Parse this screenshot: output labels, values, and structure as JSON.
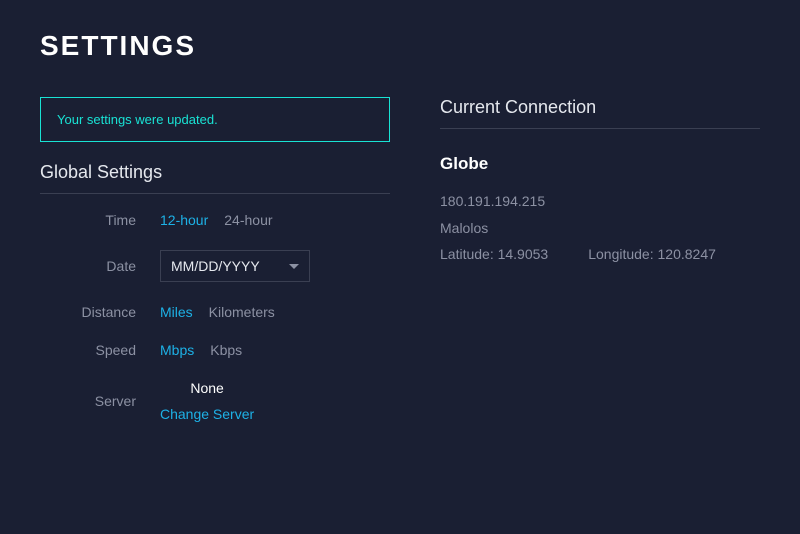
{
  "page": {
    "title": "SETTINGS"
  },
  "alert": {
    "message": "Your settings were updated."
  },
  "global": {
    "heading": "Global Settings",
    "time": {
      "label": "Time",
      "options": {
        "twelve": "12-hour",
        "twentyfour": "24-hour"
      }
    },
    "date": {
      "label": "Date",
      "selected": "MM/DD/YYYY"
    },
    "distance": {
      "label": "Distance",
      "options": {
        "miles": "Miles",
        "km": "Kilometers"
      }
    },
    "speed": {
      "label": "Speed",
      "options": {
        "mbps": "Mbps",
        "kbps": "Kbps"
      }
    },
    "server": {
      "label": "Server",
      "value": "None",
      "change": "Change Server"
    }
  },
  "connection": {
    "heading": "Current Connection",
    "isp": "Globe",
    "ip": "180.191.194.215",
    "city": "Malolos",
    "lat_label": "Latitude: 14.9053",
    "lon_label": "Longitude: 120.8247"
  }
}
